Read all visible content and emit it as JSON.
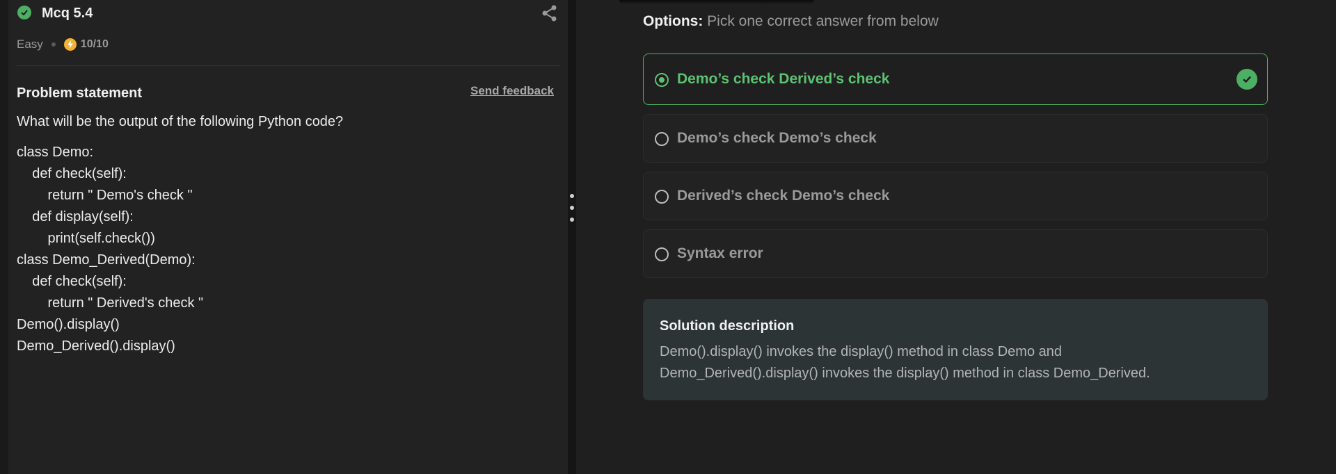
{
  "problem": {
    "title": "Mcq 5.4",
    "difficulty": "Easy",
    "score": "10/10",
    "statement_heading": "Problem statement",
    "feedback_link": "Send feedback",
    "question": "What will be the output of the following Python code?",
    "code_lines": [
      "class Demo:",
      "    def check(self):",
      "        return \" Demo's check \"",
      "    def display(self):",
      "        print(self.check())",
      "class Demo_Derived(Demo):",
      "    def check(self):",
      "        return \" Derived's check \"",
      "Demo().display()",
      "Demo_Derived().display()"
    ]
  },
  "options": {
    "label": "Options:",
    "hint": "Pick one correct answer from below",
    "items": [
      {
        "label": "Demo’s check Derived’s check",
        "selected": true,
        "correct": true
      },
      {
        "label": "Demo’s check Demo’s check",
        "selected": false,
        "correct": false
      },
      {
        "label": "Derived’s check Demo’s check",
        "selected": false,
        "correct": false
      },
      {
        "label": "Syntax error",
        "selected": false,
        "correct": false
      }
    ]
  },
  "solution": {
    "title": "Solution description",
    "lines": [
      "Demo().display() invokes the display() method in class Demo and",
      "Demo_Derived().display() invokes the display() method in class Demo_Derived."
    ]
  },
  "icons": {
    "status": "check-circle-icon",
    "share": "share-icon",
    "score": "bolt-icon",
    "correct": "check-circle-icon",
    "resize": "vertical-dots-icon"
  },
  "colors": {
    "accent_green": "#5cc271",
    "score_yellow": "#f2b233",
    "solution_bg": "#2c3436"
  }
}
